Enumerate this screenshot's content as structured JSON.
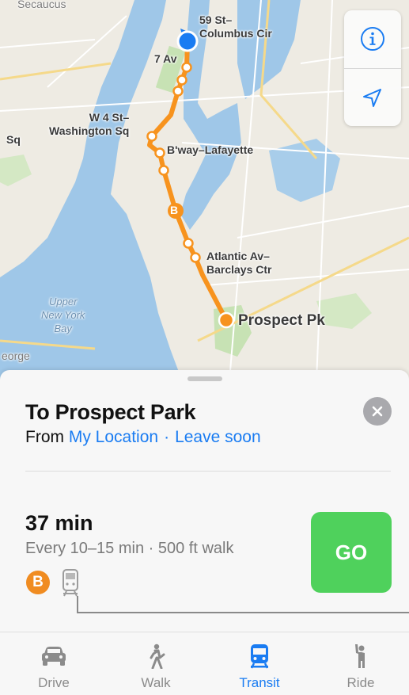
{
  "map": {
    "labels": {
      "town": "Secaucus",
      "stop_top": "59 St–\nColumbus Cir",
      "stop_7av": "7 Av",
      "stop_w4": "W 4 St–\nWashington Sq",
      "stop_sq": "Sq",
      "stop_bway": "B'way–Lafayette",
      "route_badge": "B",
      "stop_atlantic": "Atlantic Av–\nBarclays Ctr",
      "destination": "Prospect Pk",
      "water": "Upper\nNew York\nBay",
      "edge": "eorge"
    },
    "controls": {
      "info_icon": "info-icon",
      "location_icon": "location-arrow-icon"
    },
    "colors": {
      "route": "#f7931e",
      "user_location": "#1a7cf2"
    }
  },
  "sheet": {
    "title": "To Prospect Park",
    "from_prefix": "From",
    "from_location": "My Location",
    "separator": "·",
    "depart_option": "Leave soon",
    "route": {
      "duration": "37 min",
      "frequency": "Every 10–15 min · 500 ft walk",
      "line": "B",
      "line_color": "#f08c21",
      "go_label": "GO",
      "go_color": "#4fd15c"
    }
  },
  "tabs": [
    {
      "label": "Drive",
      "icon": "car-icon",
      "active": false
    },
    {
      "label": "Walk",
      "icon": "walk-icon",
      "active": false
    },
    {
      "label": "Transit",
      "icon": "train-icon",
      "active": true
    },
    {
      "label": "Ride",
      "icon": "hail-person-icon",
      "active": false
    }
  ]
}
